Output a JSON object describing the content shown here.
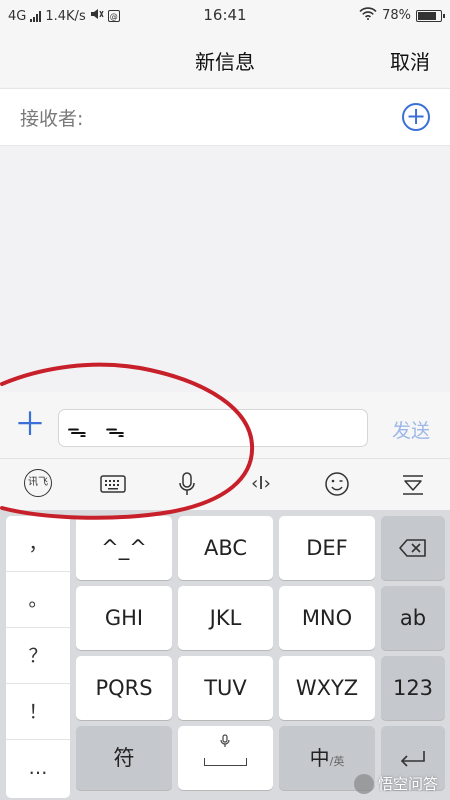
{
  "status_bar": {
    "network": "4G",
    "speed": "1.4K/s",
    "time": "16:41",
    "battery": "78%"
  },
  "header": {
    "title": "新信息",
    "cancel": "取消"
  },
  "recipient": {
    "label": "接收者:"
  },
  "compose": {
    "input_value": "ᯓ ᯓ",
    "send": "发送"
  },
  "ime_toolbar": {
    "xunfei_label": "讯飞",
    "cursor_label": "‹I›"
  },
  "keyboard": {
    "symbols": [
      "，",
      "。",
      "？",
      "！",
      "…"
    ],
    "rows": [
      [
        "^_^",
        "ABC",
        "DEF"
      ],
      [
        "GHI",
        "JKL",
        "MNO"
      ],
      [
        "PQRS",
        "TUV",
        "WXYZ"
      ]
    ],
    "side_keys": [
      "ab",
      "123"
    ],
    "bottom": {
      "symbol_key": "符",
      "lang_main": "中",
      "lang_sub": "/英"
    }
  },
  "watermark": {
    "text": "悟空问答"
  },
  "colors": {
    "accent": "#3b6fd8",
    "send_disabled": "#9db8e8",
    "annotation": "#c8202a"
  }
}
